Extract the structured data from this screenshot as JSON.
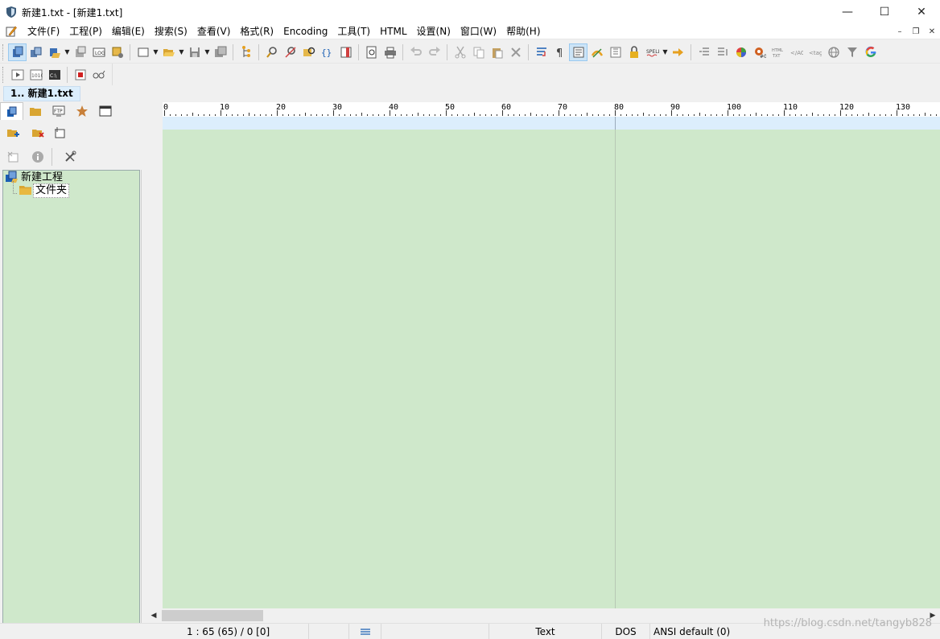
{
  "window": {
    "title": "新建1.txt - [新建1.txt]",
    "controls": {
      "minimize": "—",
      "maximize": "☐",
      "close": "✕"
    }
  },
  "menu": {
    "items": [
      "文件(F)",
      "工程(P)",
      "编辑(E)",
      "搜索(S)",
      "查看(V)",
      "格式(R)",
      "Encoding",
      "工具(T)",
      "HTML",
      "设置(N)",
      "窗口(W)",
      "帮助(H)"
    ],
    "mdi": {
      "minimize": "–",
      "restore": "❐",
      "close": "✕"
    }
  },
  "toolbar_icons": {
    "main": [
      "project-view-icon",
      "workspace-icon",
      "open-project-icon",
      "new-tab-icon",
      "log-icon",
      "plugin-icon",
      "new-file-icon",
      "open-file-icon",
      "save-icon",
      "save-all-icon",
      "tree-icon",
      "find-icon",
      "replace-icon",
      "find-in-files-icon",
      "bracket-match-icon",
      "column-mode-icon",
      "print-preview-icon",
      "print-icon",
      "undo-icon",
      "redo-icon",
      "cut-icon",
      "copy-icon",
      "paste-icon",
      "delete-icon",
      "word-wrap-icon",
      "show-symbols-icon",
      "text-mode-icon",
      "highlight-icon",
      "bookmark-icon",
      "lock-icon",
      "spell-icon",
      "goto-icon",
      "indent-icon",
      "unindent-icon",
      "color-picker-icon",
      "color-palette-icon",
      "html-txt-icon",
      "tag-icon",
      "tag-close-icon",
      "web-icon",
      "filter-icon",
      "google-icon"
    ],
    "second": [
      "play-macro-icon",
      "hex-icon",
      "cmd-icon",
      "stop-record-icon",
      "glasses-icon"
    ]
  },
  "document_tabs": [
    {
      "label": "1.. 新建1.txt",
      "active": true
    }
  ],
  "left_panel": {
    "tabs": [
      "project-tab-icon",
      "folder-tab-icon",
      "ftp-tab-icon",
      "favorites-tab-icon",
      "window-tab-icon"
    ],
    "tools_row1": [
      "add-folder-icon",
      "remove-folder-icon",
      "add-file-icon"
    ],
    "tools_row2": [
      "remove-file-icon",
      "info-icon",
      "settings-icon"
    ],
    "tree": {
      "root": "新建工程",
      "children": [
        "文件夹"
      ]
    }
  },
  "ruler": {
    "labels": [
      "0",
      "10",
      "20",
      "30",
      "40",
      "50",
      "60",
      "70",
      "80",
      "90",
      "100",
      "110",
      "120",
      "130"
    ],
    "edge_column": 80
  },
  "status": {
    "position": "1 : 65 (65) / 0   [0]",
    "mode": "Text",
    "line_ending": "DOS",
    "encoding": "ANSI default (0)"
  },
  "watermark": "https://blog.csdn.net/tangyb828",
  "colors": {
    "editor_bg": "#cfe8cb",
    "tab_active_bg": "#dceefc",
    "edge_line": "#b7c8b4"
  }
}
